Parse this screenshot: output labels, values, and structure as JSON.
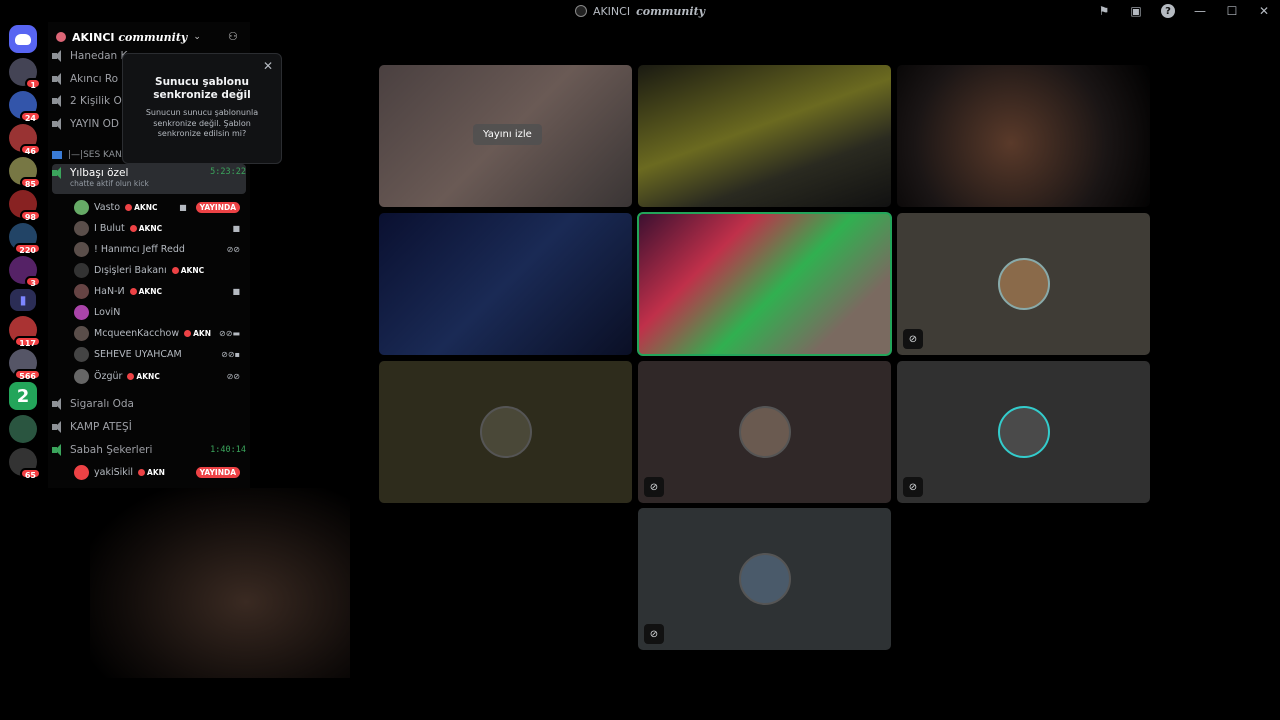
{
  "window": {
    "title_plain": "AKINCI",
    "title_script": "community"
  },
  "server": {
    "name_plain": "AKINCI",
    "name_script": "community"
  },
  "rail": {
    "badges": [
      "1",
      "24",
      "46",
      "85",
      "98",
      "220",
      "3",
      "117",
      "566",
      "65"
    ]
  },
  "channels": [
    {
      "name": "Hanedan K"
    },
    {
      "name": "Akıncı Ro"
    },
    {
      "name": "2 Kişilik O"
    },
    {
      "name": "YAYIN OD"
    }
  ],
  "category": {
    "name": "|—|SES KANA"
  },
  "active_channel": {
    "name": "Yılbaşı özel",
    "status": "chatte aktif olun kick",
    "timer": "5:23:22"
  },
  "voice_users": [
    {
      "name": "Vasto",
      "tag": "AKNC",
      "live": "YAYINDA"
    },
    {
      "name": "I Bulut",
      "tag": "AKNC"
    },
    {
      "name": "! Hanımcı Jeff Redd",
      "tag": ""
    },
    {
      "name": "Dışişleri Bakanı",
      "tag": "AKNC"
    },
    {
      "name": "HaN-И",
      "tag": "AKNC"
    },
    {
      "name": "LoviN",
      "tag": ""
    },
    {
      "name": "McqueenKacchow",
      "tag": "AKN"
    },
    {
      "name": "SEHEVE UYAHCAM",
      "tag": ""
    },
    {
      "name": "Özgür",
      "tag": "AKNC"
    }
  ],
  "channels_lower": [
    {
      "name": "Sigaralı Oda"
    },
    {
      "name": "KAMP ATEŞİ"
    },
    {
      "name": "Sabah Şekerleri",
      "timer": "1:40:14"
    }
  ],
  "lower_user": {
    "name": "yakiSikil",
    "tag": "AKN",
    "live": "YAYINDA"
  },
  "tooltip": {
    "title": "Sunucu şablonu senkronize değil",
    "body": "Sunucun sunucu şablonunla senkronize değil. Şablon senkronize edilsin mi?"
  },
  "stream_tile": {
    "watch_label": "Yayını izle"
  },
  "colors": {
    "accent_green": "#23a55a",
    "live_red": "#ed4245",
    "discord_blurple": "#5865f2"
  }
}
